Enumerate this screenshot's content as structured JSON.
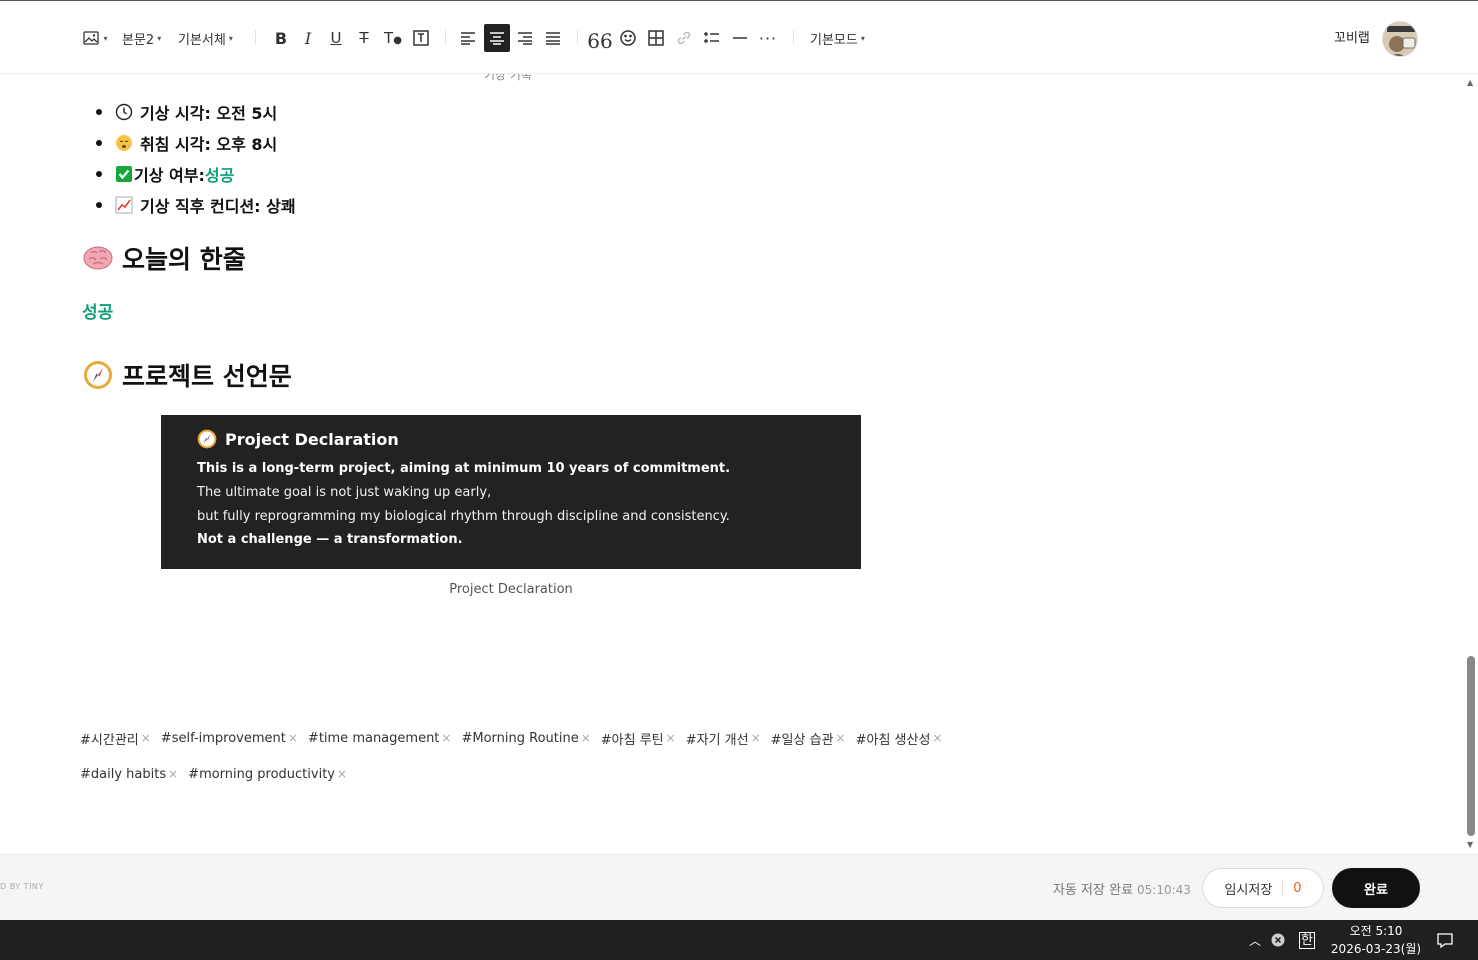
{
  "toolbar": {
    "paragraph_style": "본문2",
    "font_family": "기본서체",
    "mode": "기본모드",
    "user_name": "꼬비랩"
  },
  "content": {
    "cut_text": "기상 기록",
    "bullets": [
      {
        "icon": "clock-icon",
        "label": "기상 시각: 오전 5시",
        "value": ""
      },
      {
        "icon": "sleepy-face-icon",
        "label": "취침 시각: 오후 8시",
        "value": ""
      },
      {
        "icon": "check-box-icon",
        "label": "기상 여부: ",
        "value": "성공"
      },
      {
        "icon": "chart-up-icon",
        "label": "기상 직후 컨디션: 상쾌",
        "value": ""
      }
    ],
    "heading_oneline": "오늘의 한줄",
    "oneline_text": "성공",
    "heading_project": "프로젝트 선언문",
    "declaration": {
      "title": "Project Declaration",
      "line1": "This is a long-term project, aiming at minimum 10 years of commitment.",
      "line2": "The ultimate goal is not just waking up early,",
      "line3": "but fully reprogramming my biological rhythm through discipline and consistency.",
      "line4": "Not a challenge — a transformation."
    },
    "caption": "Project Declaration",
    "tags_row1": [
      "#시간관리",
      "#self-improvement",
      "#time management",
      "#Morning Routine",
      "#아침 루틴",
      "#자기 개선",
      "#일상 습관",
      "#아침 생산성"
    ],
    "tags_row2": [
      "#daily habits",
      "#morning productivity"
    ],
    "tag_remove_glyph": "×"
  },
  "footer": {
    "powered_by": "D BY TINY",
    "autosave_label": "자동 저장 완료",
    "autosave_time": "05:10:43",
    "draft_label": "임시저장",
    "draft_count": "0",
    "done_label": "완료"
  },
  "taskbar": {
    "ime": "한",
    "time": "오전 5:10",
    "date": "2026-03-23(월)"
  }
}
